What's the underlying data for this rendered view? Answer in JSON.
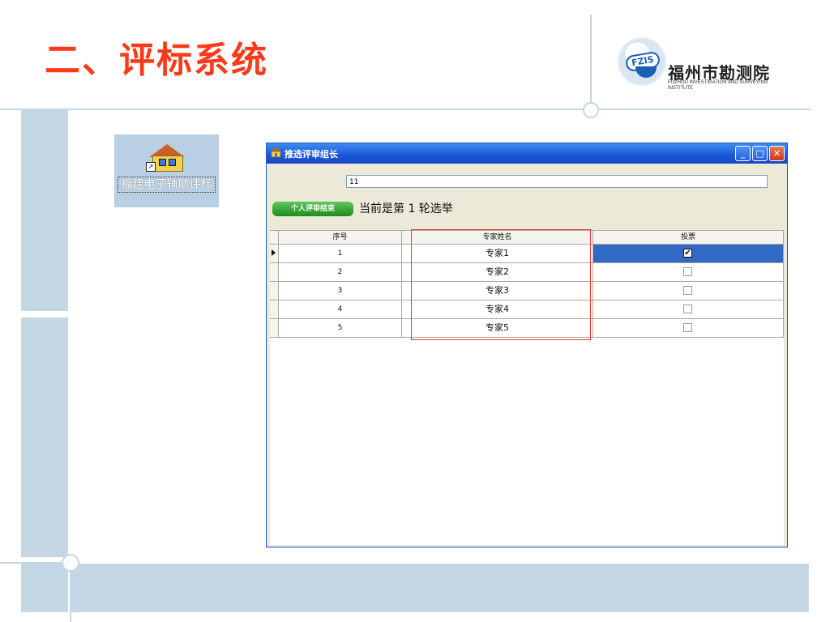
{
  "slide": {
    "title": "二、评标系统"
  },
  "logo": {
    "badge_text": "FZIS",
    "name": "福州市勘测院",
    "subtitle": "FUZHOU INVESTIGATION AND SURVEYING INSTITUTE"
  },
  "desktop_icon": {
    "label": "福建电子辅助评标"
  },
  "window": {
    "title": "推选评审组长",
    "controls": {
      "minimize": "_",
      "maximize": "□",
      "close": "✕"
    },
    "input_value": "11",
    "end_button_label": "个人评审结束",
    "round_text": "当前是第 1 轮选举",
    "grid": {
      "columns": [
        "序号",
        "专家姓名",
        "投票"
      ],
      "rows": [
        {
          "no": "1",
          "name": "专家1",
          "voted": true,
          "selected": true
        },
        {
          "no": "2",
          "name": "专家2",
          "voted": false,
          "selected": false
        },
        {
          "no": "3",
          "name": "专家3",
          "voted": false,
          "selected": false
        },
        {
          "no": "4",
          "name": "专家4",
          "voted": false,
          "selected": false
        },
        {
          "no": "5",
          "name": "专家5",
          "voted": false,
          "selected": false
        }
      ]
    },
    "checkmark": "✔"
  },
  "colors": {
    "title_red": "#ff3a1a",
    "band_blue": "#c5d6e4",
    "selection": "#316ac5",
    "highlight_red": "#e43b3b"
  }
}
